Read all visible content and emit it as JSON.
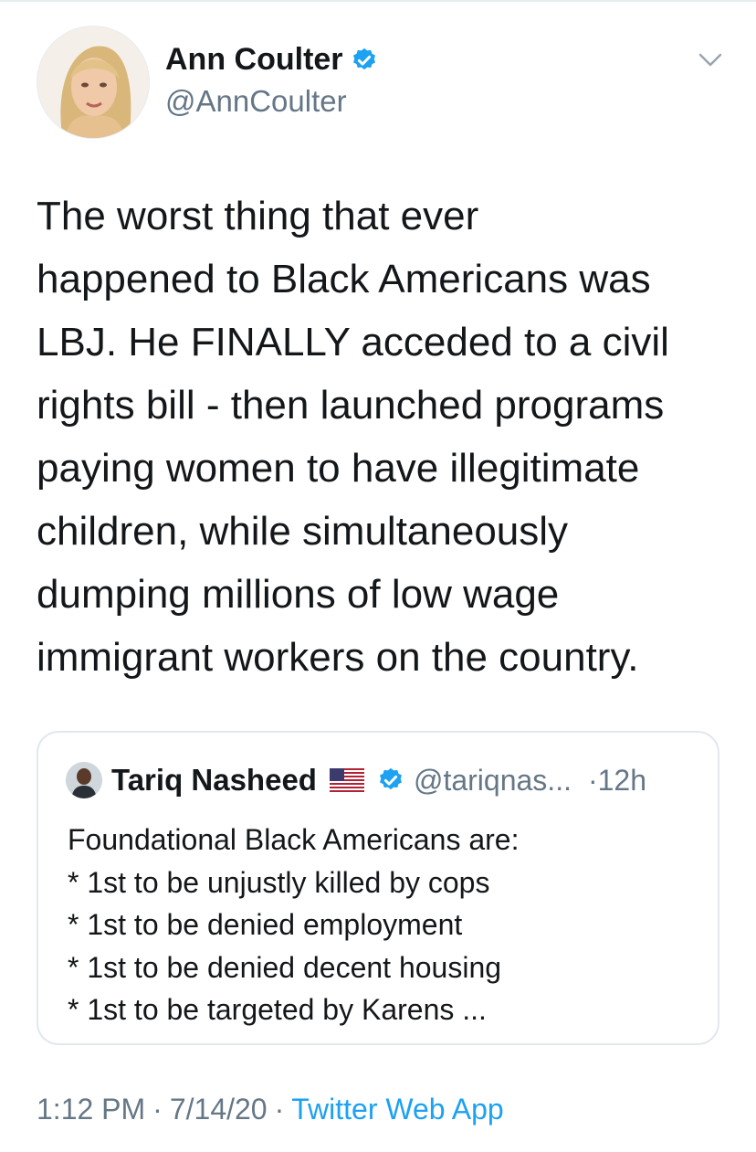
{
  "author": {
    "name": "Ann Coulter",
    "handle": "@AnnCoulter",
    "verified": true
  },
  "tweet": {
    "lines": [
      "The worst thing that ever",
      "happened to Black Americans was",
      "LBJ.  He FINALLY acceded to a civil",
      "rights bill - then launched programs",
      "paying women to have illegitimate",
      "children, while simultaneously",
      "dumping millions of low wage",
      "immigrant workers on the country."
    ]
  },
  "quoted_tweet": {
    "name": "Tariq Nasheed",
    "flag_icon": "us-flag-icon",
    "verified": true,
    "handle": "@tariqnas...",
    "dot": "·",
    "time": "12h",
    "lines": [
      "Foundational Black Americans are:",
      "* 1st to be unjustly killed by cops",
      "* 1st to be denied employment",
      "* 1st to be denied decent housing",
      "* 1st to be targeted by Karens ..."
    ]
  },
  "footer": {
    "time": "1:12 PM",
    "separator": "·",
    "date": "7/14/20",
    "source": "Twitter Web App"
  },
  "colors": {
    "text": "#14171a",
    "secondary": "#657786",
    "link": "#1da1f2",
    "verified": "#1da1f2",
    "border": "#e1e8ed"
  }
}
